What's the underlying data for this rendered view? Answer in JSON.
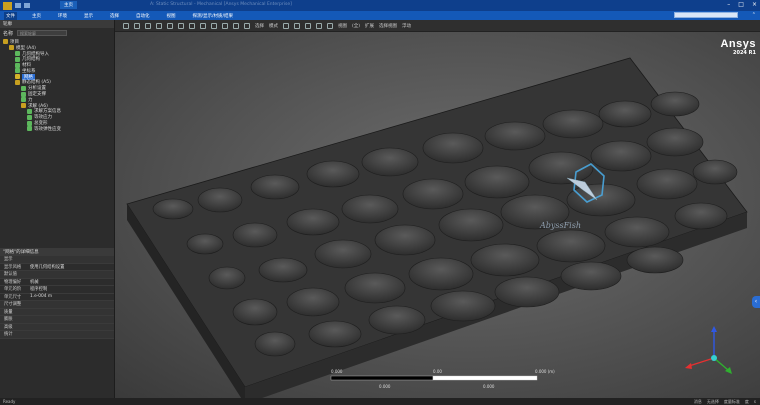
{
  "titlebar": {
    "tabs": [
      "文件",
      "主页",
      "模型",
      "显示",
      "选择",
      "自动化",
      "视图",
      "Workbench配置"
    ],
    "active_tab": "主页",
    "title": "A: Static Structural - Mechanical [Ansys Mechanical Enterprise]"
  },
  "ribbon": {
    "tabs": [
      "文件",
      "主页",
      "环境",
      "显示",
      "选择",
      "自动化",
      "视图",
      "探测/显示/材质/结果"
    ]
  },
  "toolbar": {
    "items": [
      "选择",
      "模式",
      "",
      "",
      "",
      "",
      "视图",
      "(全)",
      "扩展",
      "选择视图",
      "浮动"
    ]
  },
  "tree": {
    "header": "轮廓",
    "filter_label": "名称",
    "search_placeholder": "搜索轮廓",
    "rows": [
      {
        "label": "项目",
        "indent": 0,
        "icon": "project-icon",
        "color": "#c8a020"
      },
      {
        "label": "模型 (A4)",
        "indent": 1,
        "icon": "model-icon",
        "color": "#c8a020"
      },
      {
        "label": "几何结构导入",
        "indent": 2,
        "icon": "import-icon",
        "color": "#5db85d"
      },
      {
        "label": "几何结构",
        "indent": 2,
        "icon": "geometry-icon",
        "color": "#5db85d"
      },
      {
        "label": "材料",
        "indent": 2,
        "icon": "material-icon",
        "color": "#5db85d"
      },
      {
        "label": "坐标系",
        "indent": 2,
        "icon": "coordinate-icon",
        "color": "#5db85d"
      },
      {
        "label": "网格",
        "indent": 2,
        "icon": "mesh-icon",
        "color": "#d4b42a"
      },
      {
        "label": "静态结构 (A5)",
        "indent": 2,
        "icon": "static-icon",
        "color": "#c8a020"
      },
      {
        "label": "分析设置",
        "indent": 3,
        "icon": "settings-icon",
        "color": "#5db85d"
      },
      {
        "label": "固定支撑",
        "indent": 3,
        "icon": "support-icon",
        "color": "#5db85d"
      },
      {
        "label": "力",
        "indent": 3,
        "icon": "force-icon",
        "color": "#5db85d"
      },
      {
        "label": "求解 (A6)",
        "indent": 3,
        "icon": "solution-icon",
        "color": "#c8a020"
      },
      {
        "label": "求解方案信息",
        "indent": 4,
        "icon": "info-icon",
        "color": "#5db85d"
      },
      {
        "label": "等效应力",
        "indent": 4,
        "icon": "stress-icon",
        "color": "#5db85d"
      },
      {
        "label": "总变形",
        "indent": 4,
        "icon": "deform-icon",
        "color": "#5db85d"
      },
      {
        "label": "等效弹性应变",
        "indent": 4,
        "icon": "strain-icon",
        "color": "#5db85d"
      }
    ]
  },
  "details": {
    "header": "\"网格\"的详细信息",
    "rows": [
      {
        "k": "显示",
        "v": ""
      },
      {
        "k": "显示风格",
        "v": "使用几何结构设置"
      },
      {
        "k": "默认值",
        "v": ""
      },
      {
        "k": "物理偏好",
        "v": "机械"
      },
      {
        "k": "单元的阶",
        "v": "程序控制"
      },
      {
        "k": "单元尺寸",
        "v": "1.e-004 m"
      },
      {
        "k": "尺寸调整",
        "v": ""
      },
      {
        "k": "质量",
        "v": ""
      },
      {
        "k": "膨胀",
        "v": ""
      },
      {
        "k": "高级",
        "v": ""
      },
      {
        "k": "统计",
        "v": ""
      }
    ]
  },
  "brand": {
    "name": "Ansys",
    "version": "2024 R1"
  },
  "watermark": "AbyssFish",
  "scale": {
    "ticks_top": [
      "0.000",
      "0.00",
      "0.000 (m)"
    ],
    "ticks_bottom": [
      "0.000",
      "0.000"
    ]
  },
  "status": {
    "left": "Ready",
    "right": [
      "消息",
      "无选择",
      "度量标准",
      "度",
      "s"
    ]
  },
  "colors": {
    "ribbon": "#1459b8",
    "titlebar": "#0e3f8c",
    "axis_x": "#e53030",
    "axis_y": "#2fb02f",
    "axis_z": "#2f58e5",
    "axis_center": "#35d0d0"
  }
}
